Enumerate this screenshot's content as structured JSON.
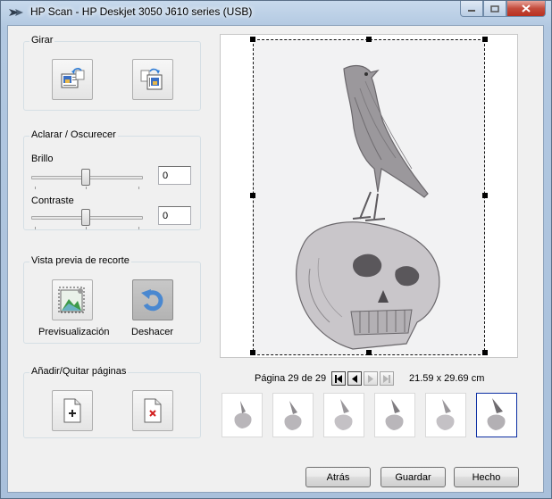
{
  "window": {
    "title": "HP Scan - HP Deskjet 3050 J610 series (USB)"
  },
  "rotate": {
    "label": "Girar"
  },
  "adjust": {
    "label": "Aclarar / Oscurecer",
    "brightness_label": "Brillo",
    "brightness_value": "0",
    "contrast_label": "Contraste",
    "contrast_value": "0"
  },
  "crop_preview": {
    "label": "Vista previa de recorte",
    "preview_label": "Previsualización",
    "undo_label": "Deshacer"
  },
  "pages": {
    "label": "Añadir/Quitar páginas"
  },
  "pager": {
    "text": "Página 29 de 29",
    "size": "21.59 x 29.69 cm"
  },
  "thumbnails": {
    "count": 6,
    "selected": 6
  },
  "footer": {
    "back": "Atrás",
    "save": "Guardar",
    "done": "Hecho"
  },
  "colors": {
    "accent": "#0b2ea3",
    "window_frame": "#b2c8e1",
    "close": "#c44b3c"
  },
  "icons": [
    "hp-logo-icon",
    "rotate-left-icon",
    "rotate-right-icon",
    "crop-preview-icon",
    "undo-icon",
    "add-page-icon",
    "remove-page-icon",
    "first-page-icon",
    "prev-page-icon",
    "next-page-icon",
    "last-page-icon"
  ]
}
